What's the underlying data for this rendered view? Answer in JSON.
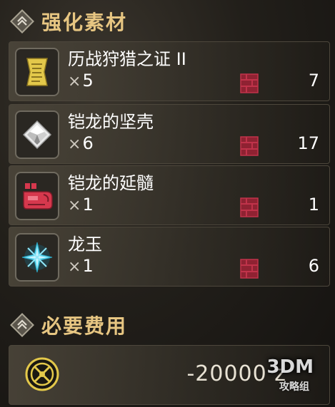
{
  "sections": {
    "materials_title": "强化素材",
    "cost_title": "必要费用"
  },
  "items": [
    {
      "name": "历战狩猎之证 II",
      "qty_prefix": "×",
      "qty": "5",
      "owned": "7",
      "icon": "scroll-icon"
    },
    {
      "name": "铠龙的坚壳",
      "qty_prefix": "×",
      "qty": "6",
      "owned": "17",
      "icon": "shell-icon"
    },
    {
      "name": "铠龙的延髓",
      "qty_prefix": "×",
      "qty": "1",
      "owned": "1",
      "icon": "monster-part-icon"
    },
    {
      "name": "龙玉",
      "qty_prefix": "×",
      "qty": "1",
      "owned": "6",
      "icon": "jewel-icon"
    }
  ],
  "cost": {
    "value": "-20000 z",
    "icon": "zenny-coin-icon"
  },
  "watermark": {
    "main": "3DM",
    "sub": "攻略组"
  },
  "colors": {
    "header_gold": "#e7c682",
    "box_red": "#c0334a",
    "scroll_yellow": "#e3c84a",
    "jewel_cyan": "#5fd6ee",
    "part_red": "#d6384d"
  }
}
